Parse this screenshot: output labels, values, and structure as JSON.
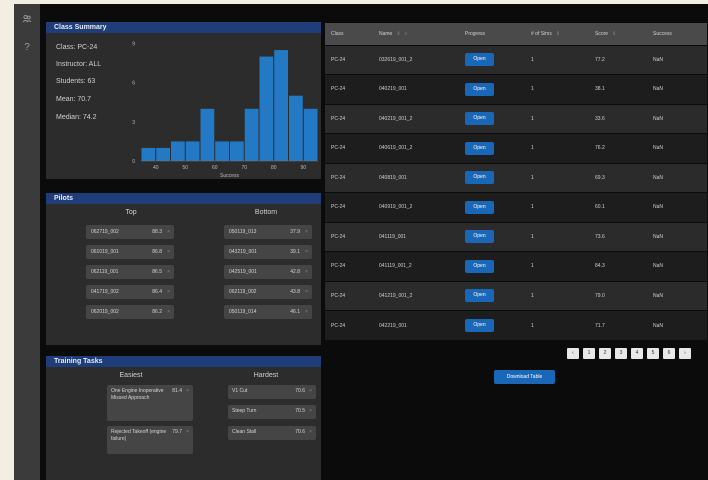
{
  "rail": {
    "icons": [
      "users-icon",
      "help-icon"
    ],
    "help_glyph": "?"
  },
  "class_summary": {
    "title": "Class Summary",
    "stats": [
      "Class: PC-24",
      "Instructor: ALL",
      "Students: 63",
      "Mean: 70.7",
      "Median: 74.2"
    ]
  },
  "chart_data": {
    "type": "bar",
    "xlabel": "Success",
    "ylabel": "",
    "x_ticks": [
      "40",
      "50",
      "60",
      "70",
      "80",
      "90"
    ],
    "y_ticks": [
      "0",
      "3",
      "6",
      "9"
    ],
    "xlim": [
      35,
      95
    ],
    "ylim": [
      0,
      9.5
    ],
    "bin_width": 5,
    "bins": [
      37.5,
      42.5,
      47.5,
      52.5,
      57.5,
      62.5,
      67.5,
      72.5,
      77.5,
      82.5,
      87.5,
      92.5
    ],
    "values": [
      1,
      1,
      1.5,
      1.5,
      4,
      1.5,
      1.5,
      4,
      8,
      8.5,
      5,
      4
    ],
    "color": "#2379c4"
  },
  "pilots": {
    "title": "Pilots",
    "top_label": "Top",
    "bottom_label": "Bottom",
    "top": [
      {
        "name": "062719_002",
        "value": "88.3"
      },
      {
        "name": "061019_001",
        "value": "86.8"
      },
      {
        "name": "062119_001",
        "value": "86.5"
      },
      {
        "name": "041719_002",
        "value": "86.4"
      },
      {
        "name": "062019_002",
        "value": "86.2"
      }
    ],
    "bottom": [
      {
        "name": "050119_013",
        "value": "37.9"
      },
      {
        "name": "043219_001",
        "value": "39.1"
      },
      {
        "name": "042519_001",
        "value": "42.8"
      },
      {
        "name": "062119_002",
        "value": "43.8"
      },
      {
        "name": "050119_014",
        "value": "46.1"
      }
    ]
  },
  "training": {
    "title": "Training Tasks",
    "easiest_label": "Easiest",
    "hardest_label": "Hardest",
    "easiest": [
      {
        "name": "One Engine Inoperative Missed Approach",
        "value": "81.4"
      },
      {
        "name": "Rejected Takeoff (engine failure)",
        "value": "79.7"
      }
    ],
    "hardest": [
      {
        "name": "V1 Cut",
        "value": "70.6"
      },
      {
        "name": "Steep Turn",
        "value": "70.5"
      },
      {
        "name": "Clean Stall",
        "value": "70.6"
      }
    ]
  },
  "table": {
    "headers": [
      "Class",
      "Name",
      "Progress",
      "# of Sims",
      "Score",
      "Success"
    ],
    "open_label": "Open",
    "rows": [
      {
        "class": "PC-24",
        "name": "032619_001_2",
        "sims": "1",
        "score": "77.2",
        "success": "NaN"
      },
      {
        "class": "PC-24",
        "name": "040219_001",
        "sims": "1",
        "score": "38.1",
        "success": "NaN"
      },
      {
        "class": "PC-24",
        "name": "040219_001_2",
        "sims": "1",
        "score": "33.6",
        "success": "NaN"
      },
      {
        "class": "PC-24",
        "name": "040619_001_2",
        "sims": "1",
        "score": "76.2",
        "success": "NaN"
      },
      {
        "class": "PC-24",
        "name": "040819_001",
        "sims": "1",
        "score": "69.3",
        "success": "NaN"
      },
      {
        "class": "PC-24",
        "name": "040919_001_2",
        "sims": "1",
        "score": "60.1",
        "success": "NaN"
      },
      {
        "class": "PC-24",
        "name": "041119_001",
        "sims": "1",
        "score": "73.6",
        "success": "NaN"
      },
      {
        "class": "PC-24",
        "name": "041119_001_2",
        "sims": "1",
        "score": "84.3",
        "success": "NaN"
      },
      {
        "class": "PC-24",
        "name": "041219_001_2",
        "sims": "1",
        "score": "79.0",
        "success": "NaN"
      },
      {
        "class": "PC-24",
        "name": "042219_001",
        "sims": "1",
        "score": "71.7",
        "success": "NaN"
      }
    ]
  },
  "pagination": {
    "pages": [
      "‹",
      "1",
      "2",
      "3",
      "4",
      "5",
      "6",
      "›"
    ]
  },
  "download_label": "Download Table"
}
